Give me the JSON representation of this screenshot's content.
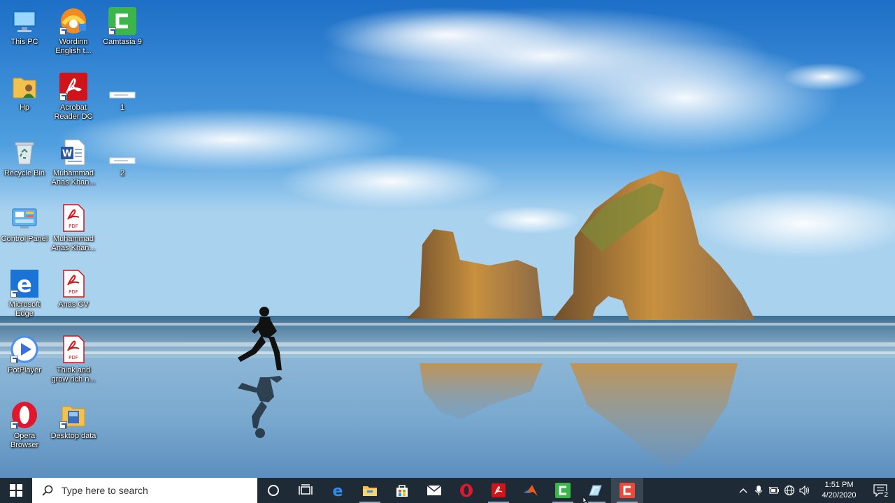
{
  "desktop": {
    "icons": [
      {
        "label": "This PC",
        "icon": "this-pc-icon"
      },
      {
        "label": "Wordinn English t...",
        "icon": "wordinn-icon"
      },
      {
        "label": "Camtasia 9",
        "icon": "camtasia-icon"
      },
      {
        "label": "Hp",
        "icon": "user-folder-icon"
      },
      {
        "label": "Acrobat Reader DC",
        "icon": "acrobat-icon"
      },
      {
        "label": "1",
        "icon": "document-thumbnail-icon"
      },
      {
        "label": "Recycle Bin",
        "icon": "recycle-bin-icon"
      },
      {
        "label": "Muhammad Anas Khan...",
        "icon": "word-document-icon"
      },
      {
        "label": "2",
        "icon": "document-thumbnail-icon"
      },
      {
        "label": "Control Panel",
        "icon": "control-panel-icon"
      },
      {
        "label": "Muhammad Anas Khan...",
        "icon": "pdf-file-icon"
      },
      {
        "label": "Microsoft Edge",
        "icon": "edge-icon"
      },
      {
        "label": "Anas CV",
        "icon": "pdf-file-icon"
      },
      {
        "label": "PotPlayer",
        "icon": "potplayer-icon"
      },
      {
        "label": "Think and grow rich n...",
        "icon": "pdf-file-icon"
      },
      {
        "label": "Opera Browser",
        "icon": "opera-icon"
      },
      {
        "label": "Desktop data",
        "icon": "folder-icon"
      }
    ],
    "pdf_badge": "PDF"
  },
  "taskbar": {
    "search_placeholder": "Type here to search",
    "pinned": [
      {
        "name": "cortana",
        "icon": "cortana-icon"
      },
      {
        "name": "task-view",
        "icon": "task-view-icon"
      },
      {
        "name": "edge",
        "icon": "edge-icon"
      },
      {
        "name": "file-explorer",
        "icon": "file-explorer-icon"
      },
      {
        "name": "store",
        "icon": "store-icon"
      },
      {
        "name": "mail",
        "icon": "mail-icon"
      },
      {
        "name": "opera",
        "icon": "opera-icon"
      },
      {
        "name": "acrobat",
        "icon": "acrobat-icon"
      },
      {
        "name": "matlab",
        "icon": "matlab-icon"
      },
      {
        "name": "camtasia-editor",
        "icon": "camtasia-icon"
      },
      {
        "name": "glass-app",
        "icon": "app-icon"
      },
      {
        "name": "camtasia-recorder",
        "icon": "camtasia-recorder-icon"
      }
    ],
    "clock": {
      "time": "1:51 PM",
      "date": "4/20/2020"
    },
    "notifications_count": "2"
  },
  "colors": {
    "taskbar": "#1e2a35",
    "accent": "#1a5fb4"
  }
}
